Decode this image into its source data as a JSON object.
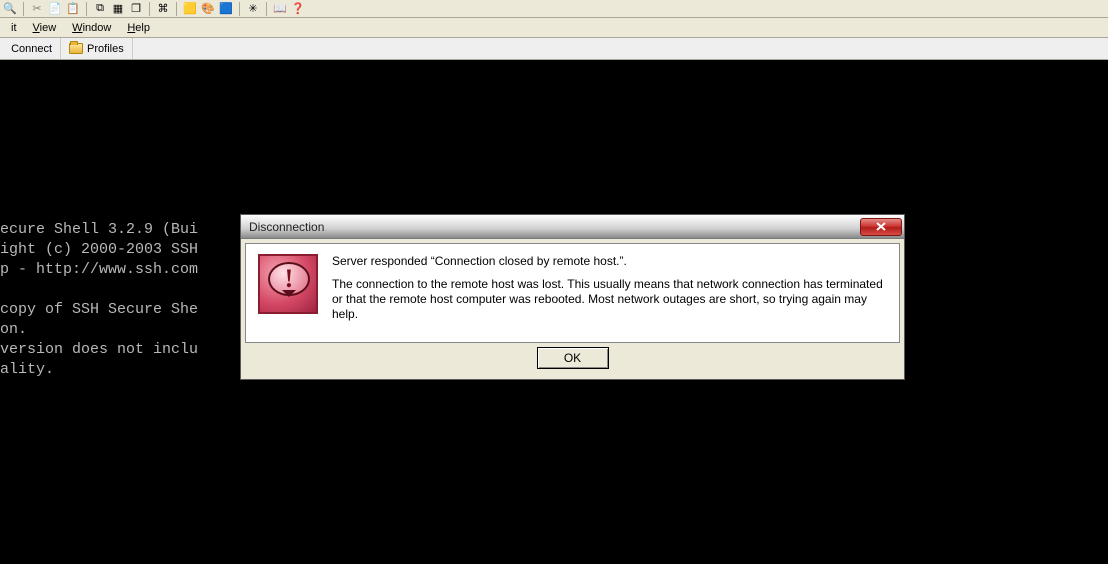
{
  "menu": {
    "edit": "Edit",
    "view": "View",
    "window": "Window",
    "help": "Help"
  },
  "quickbar": {
    "connect": "Connect",
    "profiles": "Profiles"
  },
  "terminal_lines": [
    "ecure Shell 3.2.9 (Bui",
    "ight (c) 2000-2003 SSH",
    "p - http://www.ssh.com",
    "",
    "copy of SSH Secure She",
    "on.",
    "version does not inclu",
    "ality."
  ],
  "dialog": {
    "title": "Disconnection",
    "line1": "Server responded “Connection closed by remote host.”.",
    "line2": "The connection to the remote host was lost.  This usually means that network connection has terminated or that the remote host computer was rebooted. Most network outages are short, so trying again may help.",
    "ok": "OK"
  }
}
